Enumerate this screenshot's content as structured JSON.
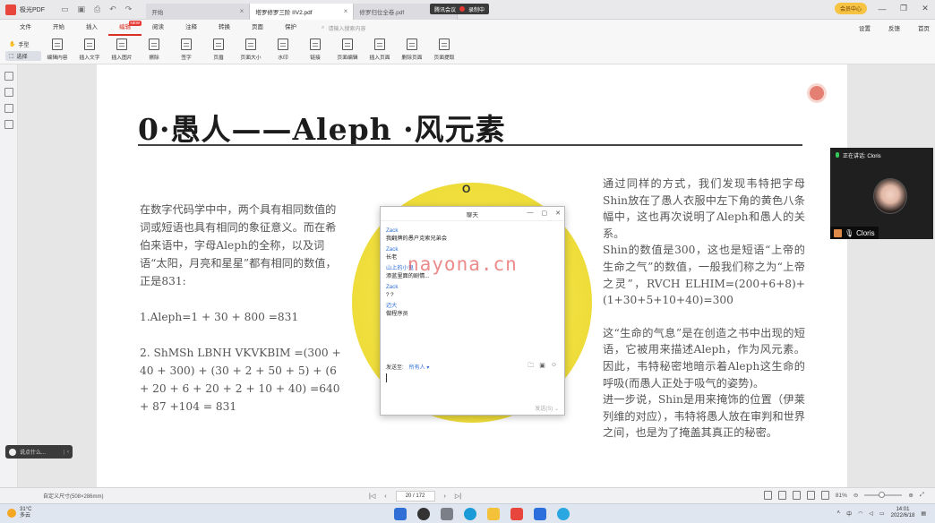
{
  "app": {
    "name": "极光PDF",
    "tabs": [
      {
        "label": "开始",
        "active": false
      },
      {
        "label": "塔罗修罗三阶 IIV2.pdf",
        "active": true
      },
      {
        "label": "修罗归位全卷.pdf",
        "active": false
      }
    ],
    "meeting_label": "腾讯会议",
    "recording_label": "录制中",
    "vip_label": "会员中心"
  },
  "menu": {
    "items": [
      "文件",
      "开始",
      "插入",
      "编辑",
      "阅读",
      "注释",
      "转换",
      "页面",
      "保护"
    ],
    "active_index": 3,
    "new_badge": "NEW",
    "search_placeholder": "请输入搜索内容",
    "right_items": [
      "设置",
      "反馈",
      "首页"
    ]
  },
  "toolbar": {
    "modes": [
      "手型",
      "选择"
    ],
    "tools": [
      "编辑内容",
      "插入文字",
      "插入图片",
      "擦除",
      "签字",
      "页眉",
      "页面大小",
      "水印",
      "链接",
      "页面编辑",
      "插入页面",
      "删除页面",
      "页面提取"
    ]
  },
  "document": {
    "title": "0·愚人——Aleph ·风元素",
    "left_paragraphs": [
      "在数字代码学中中，两个具有相同数值的词或短语也具有相同的象征意义。而在希伯来语中，字母Aleph的全称，以及词语“太阳，月亮和星星”都有相同的数值，正是831:",
      "1.Aleph=1 + 30 + 800 =831",
      "2. ShMSh LBNH VKVKBIM =(300 + 40 + 300) + (30 + 2 + 50 + 5) + (6 + 20 + 6 + 20 + 2 + 10 + 40) =640 + 87 +104 = 831"
    ],
    "right_paragraphs": [
      "通过同样的方式，我们发现韦特把字母Shin放在了愚人衣服中左下角的黄色八条幅中，这也再次说明了Aleph和愚人的关系。",
      "Shin的数值是300，这也是短语“上帝的生命之气”的数值，一般我们称之为“上帝之灵”，RVCH ELHIM=(200+6+8)+(1+30+5+10+40)=300",
      "这“生命的气息”是在创造之书中出现的短语，它被用来描述Aleph，作为风元素。因此，韦特秘密地暗示着Aleph这生命的呼吸(而愚人正处于吸气的姿势)。",
      "进一步说，Shin是用来掩饰的位置（伊莱列维的对应），韦特将愚人放在审判和世界之间，也是为了掩盖其真正的秘密。"
    ]
  },
  "chat": {
    "title": "聊天",
    "messages": [
      {
        "name": "Zack",
        "text": "我翻牌的愚户克索兄弟会"
      },
      {
        "name": "Zack",
        "text": "长老"
      },
      {
        "name": "山上的小鬼",
        "text": "添蓝里面的剧情..."
      },
      {
        "name": "Zack",
        "text": "? ?"
      },
      {
        "name": "迈大",
        "text": "做程序员"
      }
    ],
    "send_to_label": "发送至:",
    "send_to_value": "所有人",
    "send_button": "发送(S)"
  },
  "video": {
    "speaking_label": "正在讲话: Cloris",
    "name": "Cloris"
  },
  "watermark": "nayona.cn",
  "hint": {
    "text": "说点什么..."
  },
  "status": {
    "page_size": "自定义尺寸(508×286mm)",
    "page_indicator": "20 / 172",
    "zoom": "81%"
  },
  "taskbar": {
    "temperature": "31°C",
    "weather": "多云",
    "input_lang": "中",
    "time": "14:01",
    "date": "2022/6/18"
  },
  "colors": {
    "accent": "#d93025",
    "link_blue": "#2f6fd6",
    "art_yellow": "#f0df3e"
  }
}
